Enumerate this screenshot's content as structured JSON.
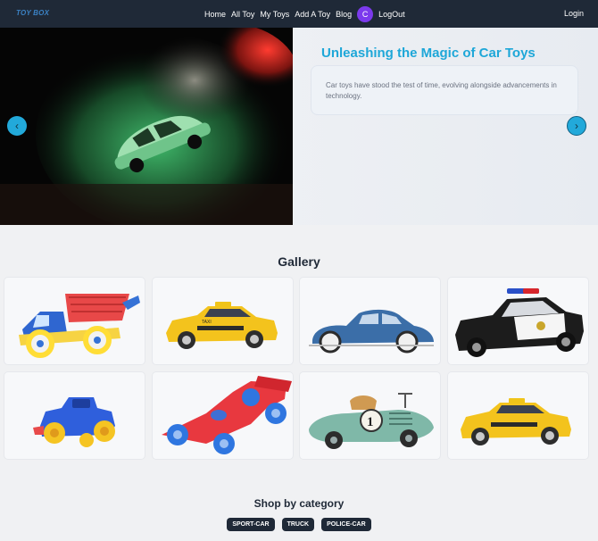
{
  "nav": {
    "logo": "TOY BOX",
    "links": [
      "Home",
      "All Toy",
      "My Toys",
      "Add A Toy",
      "Blog"
    ],
    "avatar_initial": "C",
    "logout": "LogOut",
    "login": "Login"
  },
  "hero": {
    "title": "Unleashing the Magic of Car Toys",
    "text": "Car toys have stood the test of time, evolving alongside advancements in technology.",
    "prev_label": "‹",
    "next_label": "›"
  },
  "gallery": {
    "title": "Gallery",
    "items": [
      "dump-truck-toy",
      "taxi-toy",
      "vintage-blue-car-toy",
      "police-car-toy",
      "blue-jeep-toy",
      "race-car-toy",
      "retro-racer-toy",
      "taxi-toy-small"
    ],
    "taxi_sign": "TAXI",
    "racer_number": "1"
  },
  "shop": {
    "title": "Shop by category",
    "categories": [
      "SPORT-CAR",
      "TRUCK",
      "POLICE-CAR"
    ]
  },
  "colors": {
    "navbar": "#1f2937",
    "accent": "#1ea7d8",
    "avatar": "#7c3aed"
  }
}
